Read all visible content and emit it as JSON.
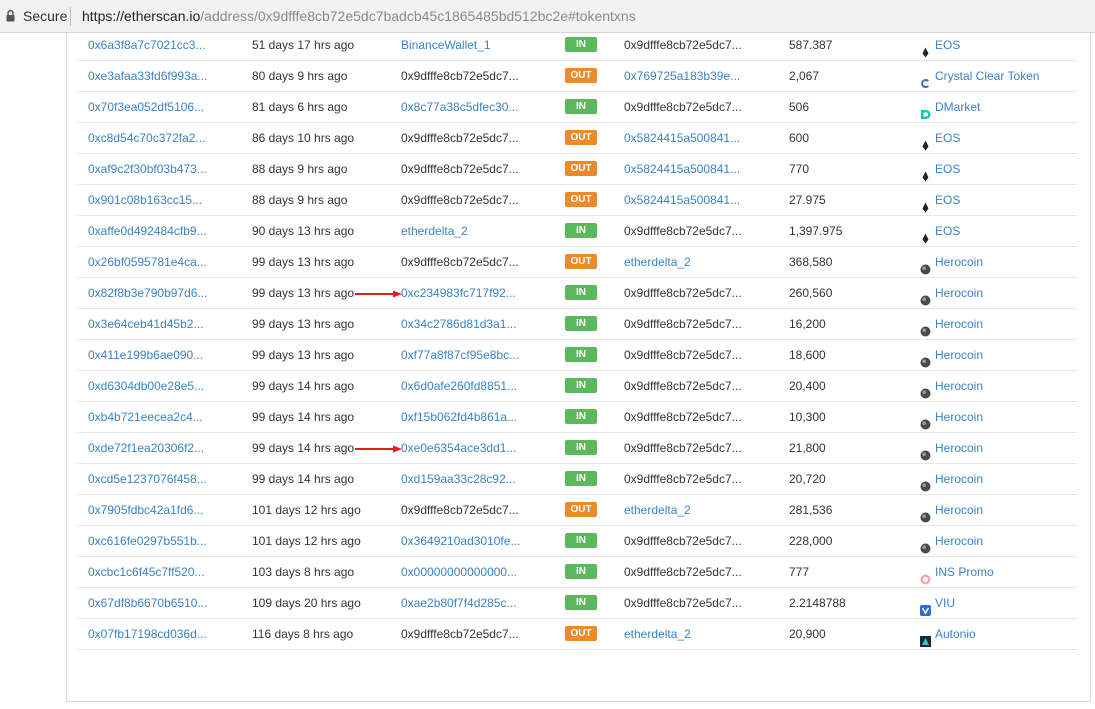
{
  "browser": {
    "secure_label": "Secure",
    "url_host": "https://etherscan.io",
    "url_path": "/address/0x9dfffe8cb72e5dc7badcb45c1865485bd512bc2e#tokentxns"
  },
  "colors": {
    "link": "#3a83c4",
    "in": "#5cb85c",
    "out": "#e98a2f",
    "arrow": "#e31b1b"
  },
  "rows": [
    {
      "hash": "0x6a3f8a7c7021cc3...",
      "age": "51 days 17 hrs ago",
      "from": "BinanceWallet_1",
      "from_link": true,
      "dir": "IN",
      "to": "0x9dfffe8cb72e5dc7...",
      "to_link": false,
      "value": "587.387",
      "token": "EOS",
      "icon": "eos-icon"
    },
    {
      "hash": "0xe3afaa33fd6f993a...",
      "age": "80 days 9 hrs ago",
      "from": "0x9dfffe8cb72e5dc7...",
      "from_link": false,
      "dir": "OUT",
      "to": "0x769725a183b39e...",
      "to_link": true,
      "value": "2,067",
      "token": "Crystal Clear Token",
      "icon": "crystal-clear-icon"
    },
    {
      "hash": "0x70f3ea052df5106...",
      "age": "81 days 6 hrs ago",
      "from": "0x8c77a38c5dfec30...",
      "from_link": true,
      "dir": "IN",
      "to": "0x9dfffe8cb72e5dc7...",
      "to_link": false,
      "value": "506",
      "token": "DMarket",
      "icon": "dmarket-icon"
    },
    {
      "hash": "0xc8d54c70c372fa2...",
      "age": "86 days 10 hrs ago",
      "from": "0x9dfffe8cb72e5dc7...",
      "from_link": false,
      "dir": "OUT",
      "to": "0x5824415a500841...",
      "to_link": true,
      "value": "600",
      "token": "EOS",
      "icon": "eos-icon"
    },
    {
      "hash": "0xaf9c2f30bf03b473...",
      "age": "88 days 9 hrs ago",
      "from": "0x9dfffe8cb72e5dc7...",
      "from_link": false,
      "dir": "OUT",
      "to": "0x5824415a500841...",
      "to_link": true,
      "value": "770",
      "token": "EOS",
      "icon": "eos-icon"
    },
    {
      "hash": "0x901c08b163cc15...",
      "age": "88 days 9 hrs ago",
      "from": "0x9dfffe8cb72e5dc7...",
      "from_link": false,
      "dir": "OUT",
      "to": "0x5824415a500841...",
      "to_link": true,
      "value": "27.975",
      "token": "EOS",
      "icon": "eos-icon"
    },
    {
      "hash": "0xaffe0d492484cfb9...",
      "age": "90 days 13 hrs ago",
      "from": "etherdelta_2",
      "from_link": true,
      "dir": "IN",
      "to": "0x9dfffe8cb72e5dc7...",
      "to_link": false,
      "value": "1,397.975",
      "token": "EOS",
      "icon": "eos-icon"
    },
    {
      "hash": "0x26bf0595781e4ca...",
      "age": "99 days 13 hrs ago",
      "from": "0x9dfffe8cb72e5dc7...",
      "from_link": false,
      "dir": "OUT",
      "to": "etherdelta_2",
      "to_link": true,
      "value": "368,580",
      "token": "Herocoin",
      "icon": "herocoin-icon"
    },
    {
      "hash": "0x82f8b3e790b97d6...",
      "age": "99 days 13 hrs ago",
      "from": "0xc234983fc717f92...",
      "from_link": true,
      "dir": "IN",
      "to": "0x9dfffe8cb72e5dc7...",
      "to_link": false,
      "value": "260,560",
      "token": "Herocoin",
      "icon": "herocoin-icon",
      "arrow": true
    },
    {
      "hash": "0x3e64ceb41d45b2...",
      "age": "99 days 13 hrs ago",
      "from": "0x34c2786d81d3a1...",
      "from_link": true,
      "dir": "IN",
      "to": "0x9dfffe8cb72e5dc7...",
      "to_link": false,
      "value": "16,200",
      "token": "Herocoin",
      "icon": "herocoin-icon"
    },
    {
      "hash": "0x411e199b6ae090...",
      "age": "99 days 13 hrs ago",
      "from": "0xf77a8f87cf95e8bc...",
      "from_link": true,
      "dir": "IN",
      "to": "0x9dfffe8cb72e5dc7...",
      "to_link": false,
      "value": "18,600",
      "token": "Herocoin",
      "icon": "herocoin-icon"
    },
    {
      "hash": "0xd6304db00e28e5...",
      "age": "99 days 14 hrs ago",
      "from": "0x6d0afe260fd8851...",
      "from_link": true,
      "dir": "IN",
      "to": "0x9dfffe8cb72e5dc7...",
      "to_link": false,
      "value": "20,400",
      "token": "Herocoin",
      "icon": "herocoin-icon"
    },
    {
      "hash": "0xb4b721eecea2c4...",
      "age": "99 days 14 hrs ago",
      "from": "0xf15b062fd4b861a...",
      "from_link": true,
      "dir": "IN",
      "to": "0x9dfffe8cb72e5dc7...",
      "to_link": false,
      "value": "10,300",
      "token": "Herocoin",
      "icon": "herocoin-icon"
    },
    {
      "hash": "0xde72f1ea20306f2...",
      "age": "99 days 14 hrs ago",
      "from": "0xe0e6354ace3dd1...",
      "from_link": true,
      "dir": "IN",
      "to": "0x9dfffe8cb72e5dc7...",
      "to_link": false,
      "value": "21,800",
      "token": "Herocoin",
      "icon": "herocoin-icon",
      "arrow": true
    },
    {
      "hash": "0xcd5e1237076f458...",
      "age": "99 days 14 hrs ago",
      "from": "0xd159aa33c28c92...",
      "from_link": true,
      "dir": "IN",
      "to": "0x9dfffe8cb72e5dc7...",
      "to_link": false,
      "value": "20,720",
      "token": "Herocoin",
      "icon": "herocoin-icon"
    },
    {
      "hash": "0x7905fdbc42a1fd6...",
      "age": "101 days 12 hrs ago",
      "from": "0x9dfffe8cb72e5dc7...",
      "from_link": false,
      "dir": "OUT",
      "to": "etherdelta_2",
      "to_link": true,
      "value": "281,536",
      "token": "Herocoin",
      "icon": "herocoin-icon"
    },
    {
      "hash": "0xc616fe0297b551b...",
      "age": "101 days 12 hrs ago",
      "from": "0x3649210ad3010fe...",
      "from_link": true,
      "dir": "IN",
      "to": "0x9dfffe8cb72e5dc7...",
      "to_link": false,
      "value": "228,000",
      "token": "Herocoin",
      "icon": "herocoin-icon"
    },
    {
      "hash": "0xcbc1c6f45c7ff520...",
      "age": "103 days 8 hrs ago",
      "from": "0x00000000000000...",
      "from_link": true,
      "dir": "IN",
      "to": "0x9dfffe8cb72e5dc7...",
      "to_link": false,
      "value": "777",
      "token": "INS Promo",
      "icon": "ins-promo-icon"
    },
    {
      "hash": "0x67df8b6670b6510...",
      "age": "109 days 20 hrs ago",
      "from": "0xae2b80f7f4d285c...",
      "from_link": true,
      "dir": "IN",
      "to": "0x9dfffe8cb72e5dc7...",
      "to_link": false,
      "value": "2.2148788",
      "token": "VIU",
      "icon": "viu-icon"
    },
    {
      "hash": "0x07fb17198cd036d...",
      "age": "116 days 8 hrs ago",
      "from": "0x9dfffe8cb72e5dc7...",
      "from_link": false,
      "dir": "OUT",
      "to": "etherdelta_2",
      "to_link": true,
      "value": "20,900",
      "token": "Autonio",
      "icon": "autonio-icon"
    }
  ]
}
